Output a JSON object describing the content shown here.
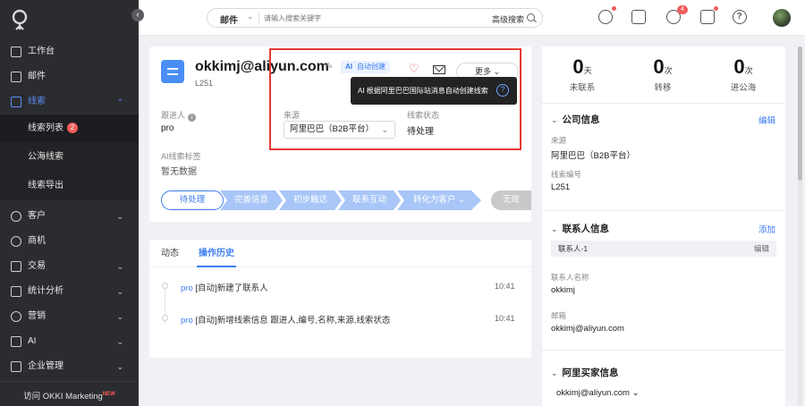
{
  "sidebar": {
    "items": [
      {
        "label": "工作台"
      },
      {
        "label": "邮件"
      },
      {
        "label": "线索"
      },
      {
        "label": "客户"
      },
      {
        "label": "商机"
      },
      {
        "label": "交易"
      },
      {
        "label": "统计分析"
      },
      {
        "label": "营销"
      },
      {
        "label": "AI"
      },
      {
        "label": "企业管理"
      }
    ],
    "sub_items": [
      {
        "label": "线索列表",
        "badge": "2"
      },
      {
        "label": "公海线索"
      },
      {
        "label": "线索导出"
      }
    ],
    "footer": "访问 OKKI Marketing",
    "footer_badge": "NEW"
  },
  "topbar": {
    "search_scope": "邮件",
    "search_placeholder": "请输入搜索关键字",
    "advanced_search": "高级搜索",
    "notification_count": "4"
  },
  "lead": {
    "title": "okkimj@aliyun.com",
    "ai_prefix": "AI",
    "ai_tag": "自动创建",
    "id": "L251",
    "more_label": "更多",
    "follower_label": "跟进人",
    "follower_value": "pro",
    "source_label": "来源",
    "source_value": "阿里巴巴（B2B平台）",
    "status_label": "线索状态",
    "status_value": "待处理",
    "ai_tag_label": "AI线索标签",
    "ai_tag_value": "暂无数据",
    "tooltip": "AI 根据阿里巴巴国际站消息自动创建线索"
  },
  "stages": [
    {
      "label": "待处理"
    },
    {
      "label": "完善信息"
    },
    {
      "label": "初步触达"
    },
    {
      "label": "联系互动"
    },
    {
      "label": "转化为客户 ⌄"
    },
    {
      "label": "无效"
    }
  ],
  "history": {
    "tabs": [
      {
        "label": "动态"
      },
      {
        "label": "操作历史"
      }
    ],
    "entries": [
      {
        "who": "pro",
        "text": " [自动]新建了联系人",
        "time": "10:41"
      },
      {
        "who": "pro",
        "text": " [自动]新增线索信息 跟进人,编号,名称,来源,线索状态",
        "time": "10:41"
      }
    ]
  },
  "stats": [
    {
      "num": "0",
      "unit": "天",
      "label": "未联系"
    },
    {
      "num": "0",
      "unit": "次",
      "label": "转移"
    },
    {
      "num": "0",
      "unit": "次",
      "label": "进公海"
    }
  ],
  "company": {
    "title": "公司信息",
    "edit": "编辑",
    "source_label": "来源",
    "source_value": "阿里巴巴（B2B平台）",
    "id_label": "线索编号",
    "id_value": "L251"
  },
  "contact": {
    "title": "联系人信息",
    "add": "添加",
    "bar_label": "联系人-1",
    "bar_edit": "编辑",
    "name_label": "联系人名称",
    "name_value": "okkimj",
    "email_label": "邮箱",
    "email_value": "okkimj@aliyun.com"
  },
  "buyer": {
    "title": "阿里买家信息",
    "email": "okkimj@aliyun.com ⌄"
  }
}
